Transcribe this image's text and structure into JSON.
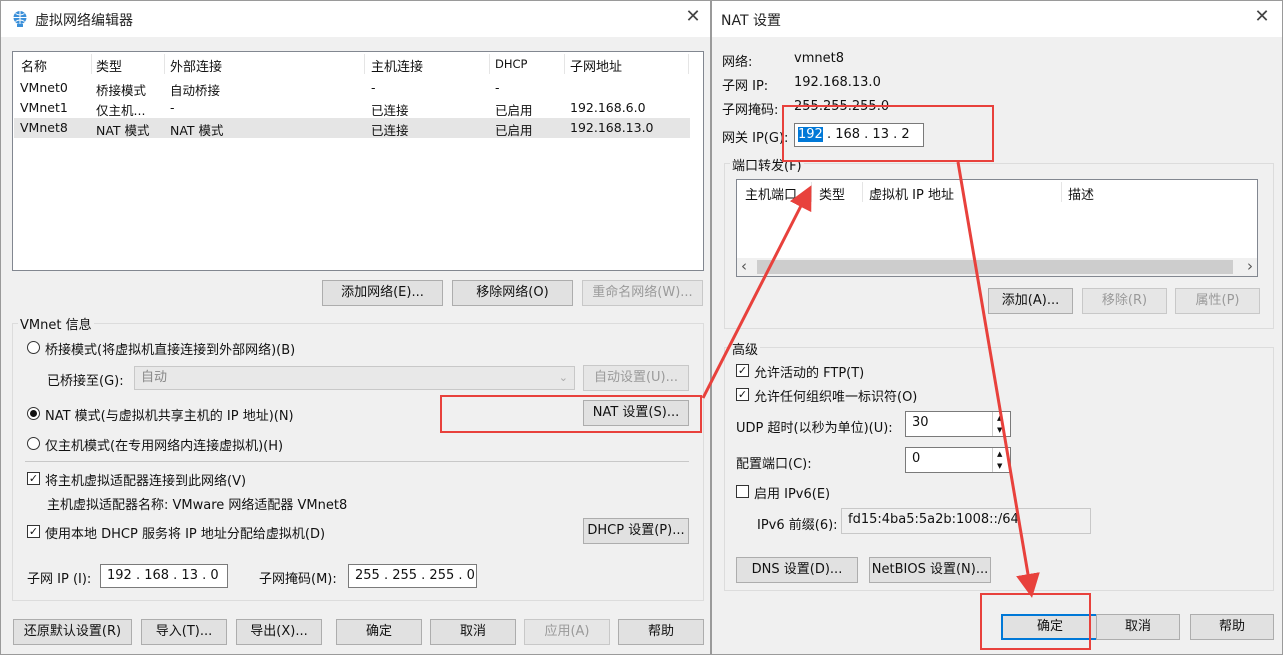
{
  "left_window": {
    "title": "虚拟网络编辑器",
    "close_label": "✕",
    "columns": [
      "名称",
      "类型",
      "外部连接",
      "主机连接",
      "DHCP",
      "子网地址"
    ],
    "rows": [
      [
        "VMnet0",
        "桥接模式",
        "自动桥接",
        "-",
        "-",
        ""
      ],
      [
        "VMnet1",
        "仅主机...",
        "-",
        "已连接",
        "已启用",
        "192.168.6.0"
      ],
      [
        "VMnet8",
        "NAT 模式",
        "NAT 模式",
        "已连接",
        "已启用",
        "192.168.13.0"
      ]
    ],
    "add_network": "添加网络(E)...",
    "remove_network": "移除网络(O)",
    "rename_network": "重命名网络(W)...",
    "vmnet_info": "VMnet 信息",
    "bridge_mode": "桥接模式(将虚拟机直接连接到外部网络)(B)",
    "bridged_to_label": "已桥接至(G):",
    "bridged_to_value": "自动",
    "auto_settings": "自动设置(U)...",
    "nat_mode": "NAT 模式(与虚拟机共享主机的 IP 地址)(N)",
    "nat_settings": "NAT 设置(S)...",
    "host_only_mode": "仅主机模式(在专用网络内连接虚拟机)(H)",
    "connect_adapter": "将主机虚拟适配器连接到此网络(V)",
    "adapter_name": "主机虚拟适配器名称: VMware 网络适配器 VMnet8",
    "use_dhcp": "使用本地 DHCP 服务将 IP 地址分配给虚拟机(D)",
    "dhcp_settings": "DHCP 设置(P)...",
    "subnet_ip_label": "子网 IP (I):",
    "subnet_ip_value": "192 . 168 . 13 . 0",
    "subnet_mask_label": "子网掩码(M):",
    "subnet_mask_value": "255 . 255 . 255 . 0",
    "restore_defaults": "还原默认设置(R)",
    "import": "导入(T)...",
    "export": "导出(X)...",
    "ok": "确定",
    "cancel": "取消",
    "apply": "应用(A)",
    "help": "帮助"
  },
  "right_window": {
    "title": "NAT 设置",
    "close_label": "✕",
    "network_label": "网络:",
    "network_value": "vmnet8",
    "subnet_ip_label": "子网 IP:",
    "subnet_ip_value": "192.168.13.0",
    "subnet_mask_label": "子网掩码:",
    "subnet_mask_value": "255.255.255.0",
    "gateway_label": "网关 IP(G):",
    "gateway_sel": "192",
    "gateway_rest": " . 168 . 13 .  2",
    "port_forwarding": "端口转发(F)",
    "pf_columns": [
      "主机端口",
      "类型",
      "虚拟机 IP 地址",
      "描述"
    ],
    "scroll_left": "‹",
    "scroll_right": "›",
    "add": "添加(A)...",
    "remove": "移除(R)",
    "properties": "属性(P)",
    "advanced": "高级",
    "allow_ftp": "允许活动的 FTP(T)",
    "allow_oui": "允许任何组织唯一标识符(O)",
    "udp_timeout_label": "UDP 超时(以秒为单位)(U):",
    "udp_timeout_value": "30",
    "config_port_label": "配置端口(C):",
    "config_port_value": "0",
    "enable_ipv6": "启用 IPv6(E)",
    "ipv6_prefix_label": "IPv6 前缀(6):",
    "ipv6_prefix_value": "fd15:4ba5:5a2b:1008::/64",
    "dns_settings": "DNS 设置(D)...",
    "netbios_settings": "NetBIOS 设置(N)...",
    "ok": "确定",
    "cancel": "取消",
    "help": "帮助"
  },
  "checks": {
    "mark": "✓"
  },
  "spin": {
    "up": "▲",
    "down": "▼"
  },
  "colors": {
    "annotation_red": "#e8413c",
    "selection_blue": "#0078d7"
  }
}
